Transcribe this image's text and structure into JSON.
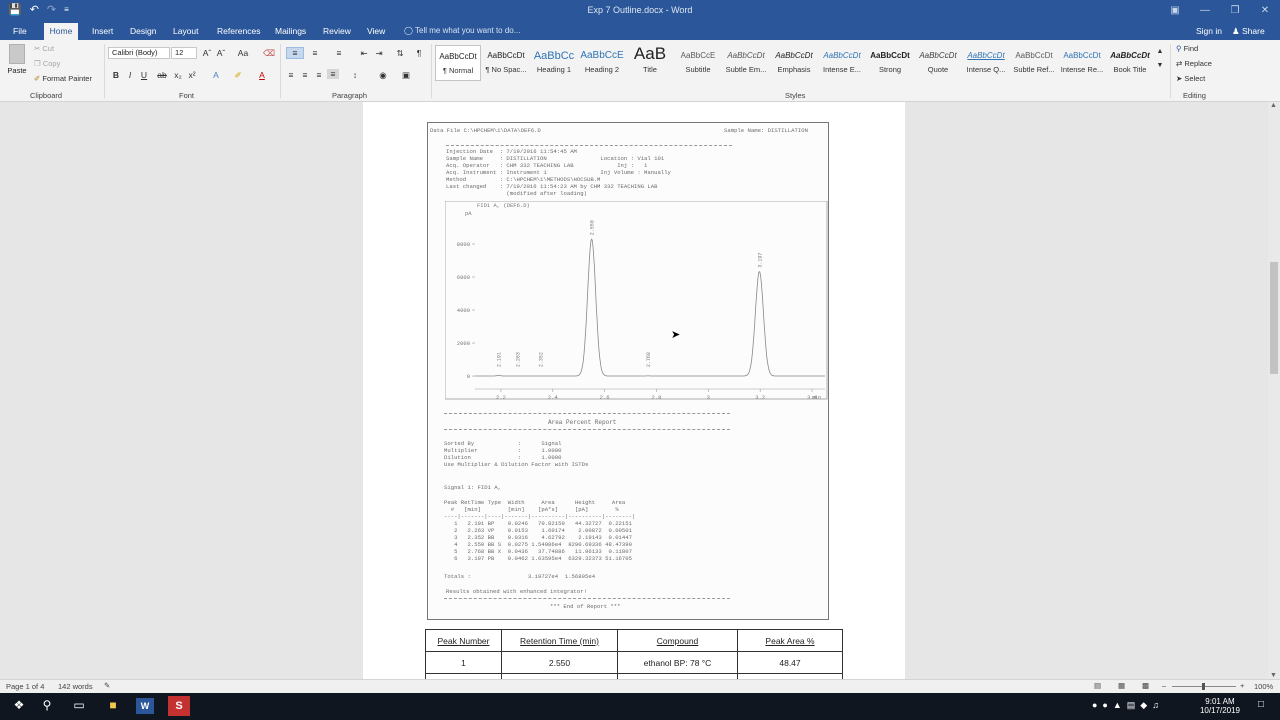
{
  "window": {
    "title": "Exp 7 Outline.docx - Word"
  },
  "tabs": [
    "File",
    "Home",
    "Insert",
    "Design",
    "Layout",
    "References",
    "Mailings",
    "Review",
    "View"
  ],
  "tell_me": "Tell me what you want to do...",
  "account": {
    "sign_in": "Sign in",
    "share": "Share"
  },
  "clipboard": {
    "paste": "Paste",
    "cut": "Cut",
    "copy": "Copy",
    "format_painter": "Format Painter",
    "label": "Clipboard"
  },
  "font": {
    "name": "Calibri (Body)",
    "size": "12",
    "label": "Font"
  },
  "paragraph": {
    "label": "Paragraph"
  },
  "styles": {
    "label": "Styles",
    "items": [
      {
        "preview": "AaBbCcDt",
        "name": "¶ Normal"
      },
      {
        "preview": "AaBbCcDt",
        "name": "¶ No Spac..."
      },
      {
        "preview": "AaBbCc",
        "name": "Heading 1"
      },
      {
        "preview": "AaBbCcE",
        "name": "Heading 2"
      },
      {
        "preview": "AaB",
        "name": "Title"
      },
      {
        "preview": "AaBbCcE",
        "name": "Subtitle"
      },
      {
        "preview": "AaBbCcDt",
        "name": "Subtle Em..."
      },
      {
        "preview": "AaBbCcDt",
        "name": "Emphasis"
      },
      {
        "preview": "AaBbCcDt",
        "name": "Intense E..."
      },
      {
        "preview": "AaBbCcDt",
        "name": "Strong"
      },
      {
        "preview": "AaBbCcDt",
        "name": "Quote"
      },
      {
        "preview": "AaBbCcDt",
        "name": "Intense Q..."
      },
      {
        "preview": "AaBbCcDt",
        "name": "Subtle Ref..."
      },
      {
        "preview": "AaBbCcDt",
        "name": "Intense Re..."
      },
      {
        "preview": "AaBbCcDt",
        "name": "Book Title"
      }
    ]
  },
  "editing": {
    "find": "Find",
    "replace": "Replace",
    "select": "Select",
    "label": "Editing"
  },
  "report": {
    "data_file": "Data File C:\\HPCHEM\\1\\DATA\\DEF6.D",
    "sample_name_hdr": "Sample Name: DISTILLATION",
    "header_lines": "Injection Date  : 7/19/2016 11:54:45 AM\nSample Name     : DISTILLATION                Location : Vial 101\nAcq. Operator   : CHM 332 TEACHING LAB             Inj :   1\nAcq. Instrument : Instrument 1                Inj Volume : Manually\nMethod          : C:\\HPCHEM\\1\\METHODS\\HOCSUB.M\nLast changed    : 7/19/2016 11:54:23 AM by CHM 332 TEACHING LAB\n                  (modified after loading)",
    "signal_label": "FID1 A, (DEF6.D)",
    "area_title": "Area Percent Report",
    "sorted_block": "Sorted By             :      Signal\nMultiplier            :      1.0000\nDilution              :      1.0000\nUse Multiplier & Dilution Factor with ISTDs",
    "signal_1": "Signal 1: FID1 A,",
    "peak_table": "Peak RetTime Type  Width     Area      Height     Area\n  #   [min]        [min]    [pA*s]     [pA]        %\n----|-------|----|-------|----------|----------|--------|\n   1   2.191 BP    0.0246   70.82150   44.32727  0.22151\n   2   2.263 VP    0.0153    1.60174    2.00872  0.00501\n   3   2.352 BB    0.0316    4.62792    2.19143  0.01447\n   4   2.550 BB S  0.0275 1.54986e4  8290.69336 48.47390\n   5   2.768 BB X  0.0436   37.74886   11.96133  0.11807\n   6   3.197 PB    0.0462 1.63595e4  6329.32373 51.16705",
    "totals": "Totals :                 3.19727e4  1.56805e4",
    "enhanced": "Results obtained with enhanced integrator!",
    "end": "*** End of Report ***"
  },
  "chart_data": {
    "type": "line",
    "title": "",
    "xlabel": "",
    "ylabel": "pA",
    "xlim": [
      2.1,
      3.45
    ],
    "ylim": [
      -300,
      10000
    ],
    "x_ticks": [
      "2.2",
      "2.4",
      "2.6",
      "2.8",
      "3",
      "3.2",
      "3.4"
    ],
    "x_unit": "min",
    "y_ticks": [
      "0",
      "2000",
      "4000",
      "6000",
      "8000"
    ],
    "peaks": [
      {
        "rt": 2.191,
        "label": "2.191",
        "height": 44
      },
      {
        "rt": 2.263,
        "label": "2.263",
        "height": 2
      },
      {
        "rt": 2.352,
        "label": "2.352",
        "height": 2
      },
      {
        "rt": 2.55,
        "label": "2.550",
        "height": 8290
      },
      {
        "rt": 2.768,
        "label": "2.768",
        "height": 12
      },
      {
        "rt": 3.197,
        "label": "3.197",
        "height": 6329
      }
    ]
  },
  "results_table": {
    "headers": [
      "Peak Number",
      "Retention Time (min)",
      "Compound",
      "Peak Area %"
    ],
    "rows": [
      [
        "1",
        "2.550",
        "ethanol BP: 78 °C",
        "48.47"
      ]
    ]
  },
  "status": {
    "page": "Page 1 of 4",
    "words": "142 words",
    "zoom": "100%"
  },
  "clock": {
    "time": "9:01 AM",
    "date": "10/17/2019"
  }
}
